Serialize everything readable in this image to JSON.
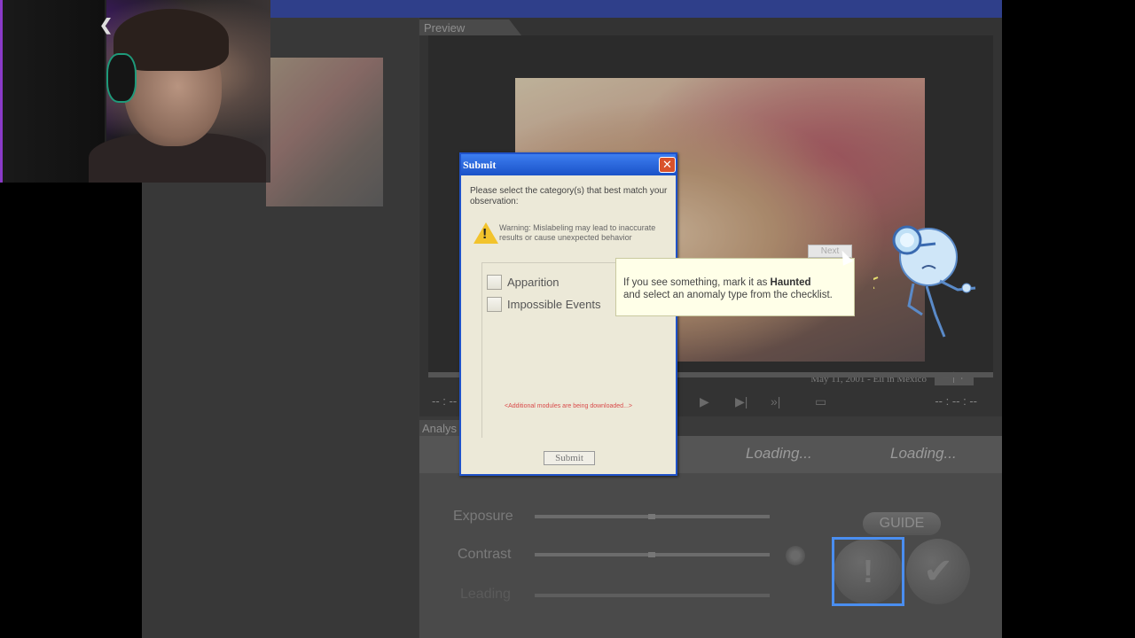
{
  "preview": {
    "tab_label": "Preview",
    "caption": "May 11, 2001 - Eli in Mexico",
    "zoom_label": "− │ +",
    "time_left": "-- : --",
    "time_right": "-- : -- : --"
  },
  "analysis": {
    "tab_label": "Analys",
    "loading_1": "Loading...",
    "loading_2": "Loading...",
    "sliders": [
      {
        "label": "Exposure",
        "level": 0.5
      },
      {
        "label": "Contrast",
        "level": 0.5
      },
      {
        "label": "Leading",
        "level": 0.5
      }
    ],
    "guide_label": "GUIDE",
    "haunted_symbol": "!",
    "confirm_symbol": "✔"
  },
  "dialog": {
    "title": "Submit",
    "close_symbol": "✕",
    "prompt": "Please select the category(s) that best match your observation:",
    "warning": "Warning: Mislabeling may lead to inaccurate results or cause unexpected behavior",
    "options": [
      {
        "label": "Apparition",
        "checked": false
      },
      {
        "label": "Impossible Events",
        "checked": false
      }
    ],
    "modules_note": "<Additional modules are being downloaded...>",
    "submit_label": "Submit"
  },
  "tooltip": {
    "line1_prefix": "If you see something, mark it as ",
    "line1_bold": "Haunted",
    "line2": "and select an anomaly type from the checklist.",
    "next_label": "Next"
  },
  "colors": {
    "titlebar": "#2f3f8a",
    "dialog_title": "#1a52c8",
    "focus_ring": "#4a8ef0",
    "modules_note": "#d94a4a",
    "warning_icon": "#f2c32c"
  },
  "icons": [
    "warning-icon",
    "close-icon",
    "play-icon",
    "mascot-magnifier-icon",
    "exclamation-icon",
    "checkmark-icon"
  ]
}
